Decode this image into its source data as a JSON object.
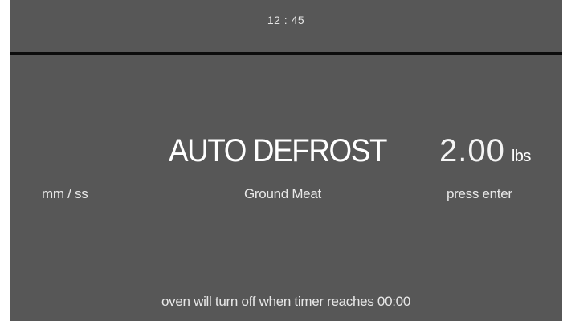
{
  "status_bar": {
    "clock": "12 : 45"
  },
  "display": {
    "mode_title": "AUTO DEFROST",
    "weight_value": "2.00",
    "weight_unit": "lbs",
    "time_format_label": "mm / ss",
    "food_type": "Ground Meat",
    "instruction": "press enter",
    "footer_note": "oven will turn off when timer reaches 00:00"
  },
  "colors": {
    "background": "#575757",
    "divider": "#0c0c0c",
    "text": "#ffffff"
  }
}
